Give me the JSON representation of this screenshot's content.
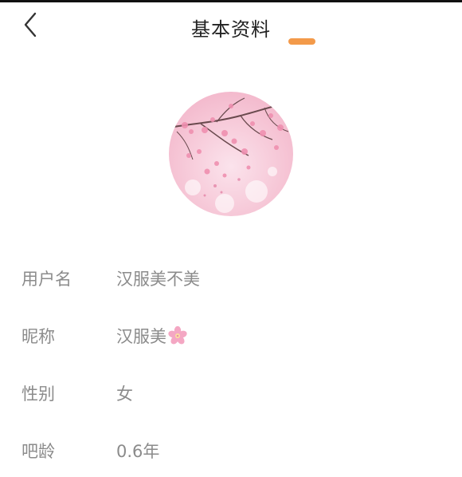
{
  "header": {
    "title": "基本资料",
    "back_icon": "chevron-left-icon",
    "indicator_color": "#f39a4a"
  },
  "avatar": {
    "description_icon": "cherry-blossom-avatar"
  },
  "profile": {
    "rows": [
      {
        "label": "用户名",
        "value": "汉服美不美"
      },
      {
        "label": "昵称",
        "value": "汉服美",
        "trailing_icon": "cherry-blossom-icon"
      },
      {
        "label": "性别",
        "value": "女"
      },
      {
        "label": "吧龄",
        "value": "0.6年"
      }
    ]
  },
  "colors": {
    "label_text": "#8b8b8b",
    "title_text": "#222222",
    "accent": "#f39a4a",
    "blossom": "#f4a7c3"
  }
}
